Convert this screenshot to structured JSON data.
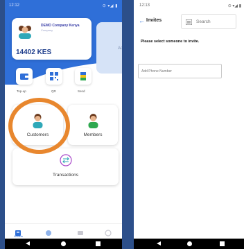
{
  "left_screen": {
    "status": {
      "time": "12:12",
      "icons": "⊙ ▾◢ ▮"
    },
    "wallet": {
      "company_name": "DEMO Company Kenya",
      "company_sub": "Company",
      "balance": "14402 KES",
      "next_card_text": "Ad"
    },
    "quick_actions": [
      {
        "label": "Top-up",
        "icon": "wallet-icon"
      },
      {
        "label": "QR",
        "icon": "qr-code-icon"
      },
      {
        "label": "Send",
        "icon": "send-icon"
      }
    ],
    "tiles": {
      "customers": "Customers",
      "members": "Members",
      "transactions": "Transactions"
    },
    "bottom_nav": {
      "active_label": "Wallets"
    },
    "accent_color": "#2f6fd8",
    "highlight_color": "#e8872e"
  },
  "right_screen": {
    "status": {
      "time": "12:13",
      "icons": "⊙ ▾◢ ▮"
    },
    "title": "Invites",
    "search_placeholder": "Search",
    "instruction": "Please select someone to invite.",
    "phone_placeholder": "Add Phone Number"
  }
}
